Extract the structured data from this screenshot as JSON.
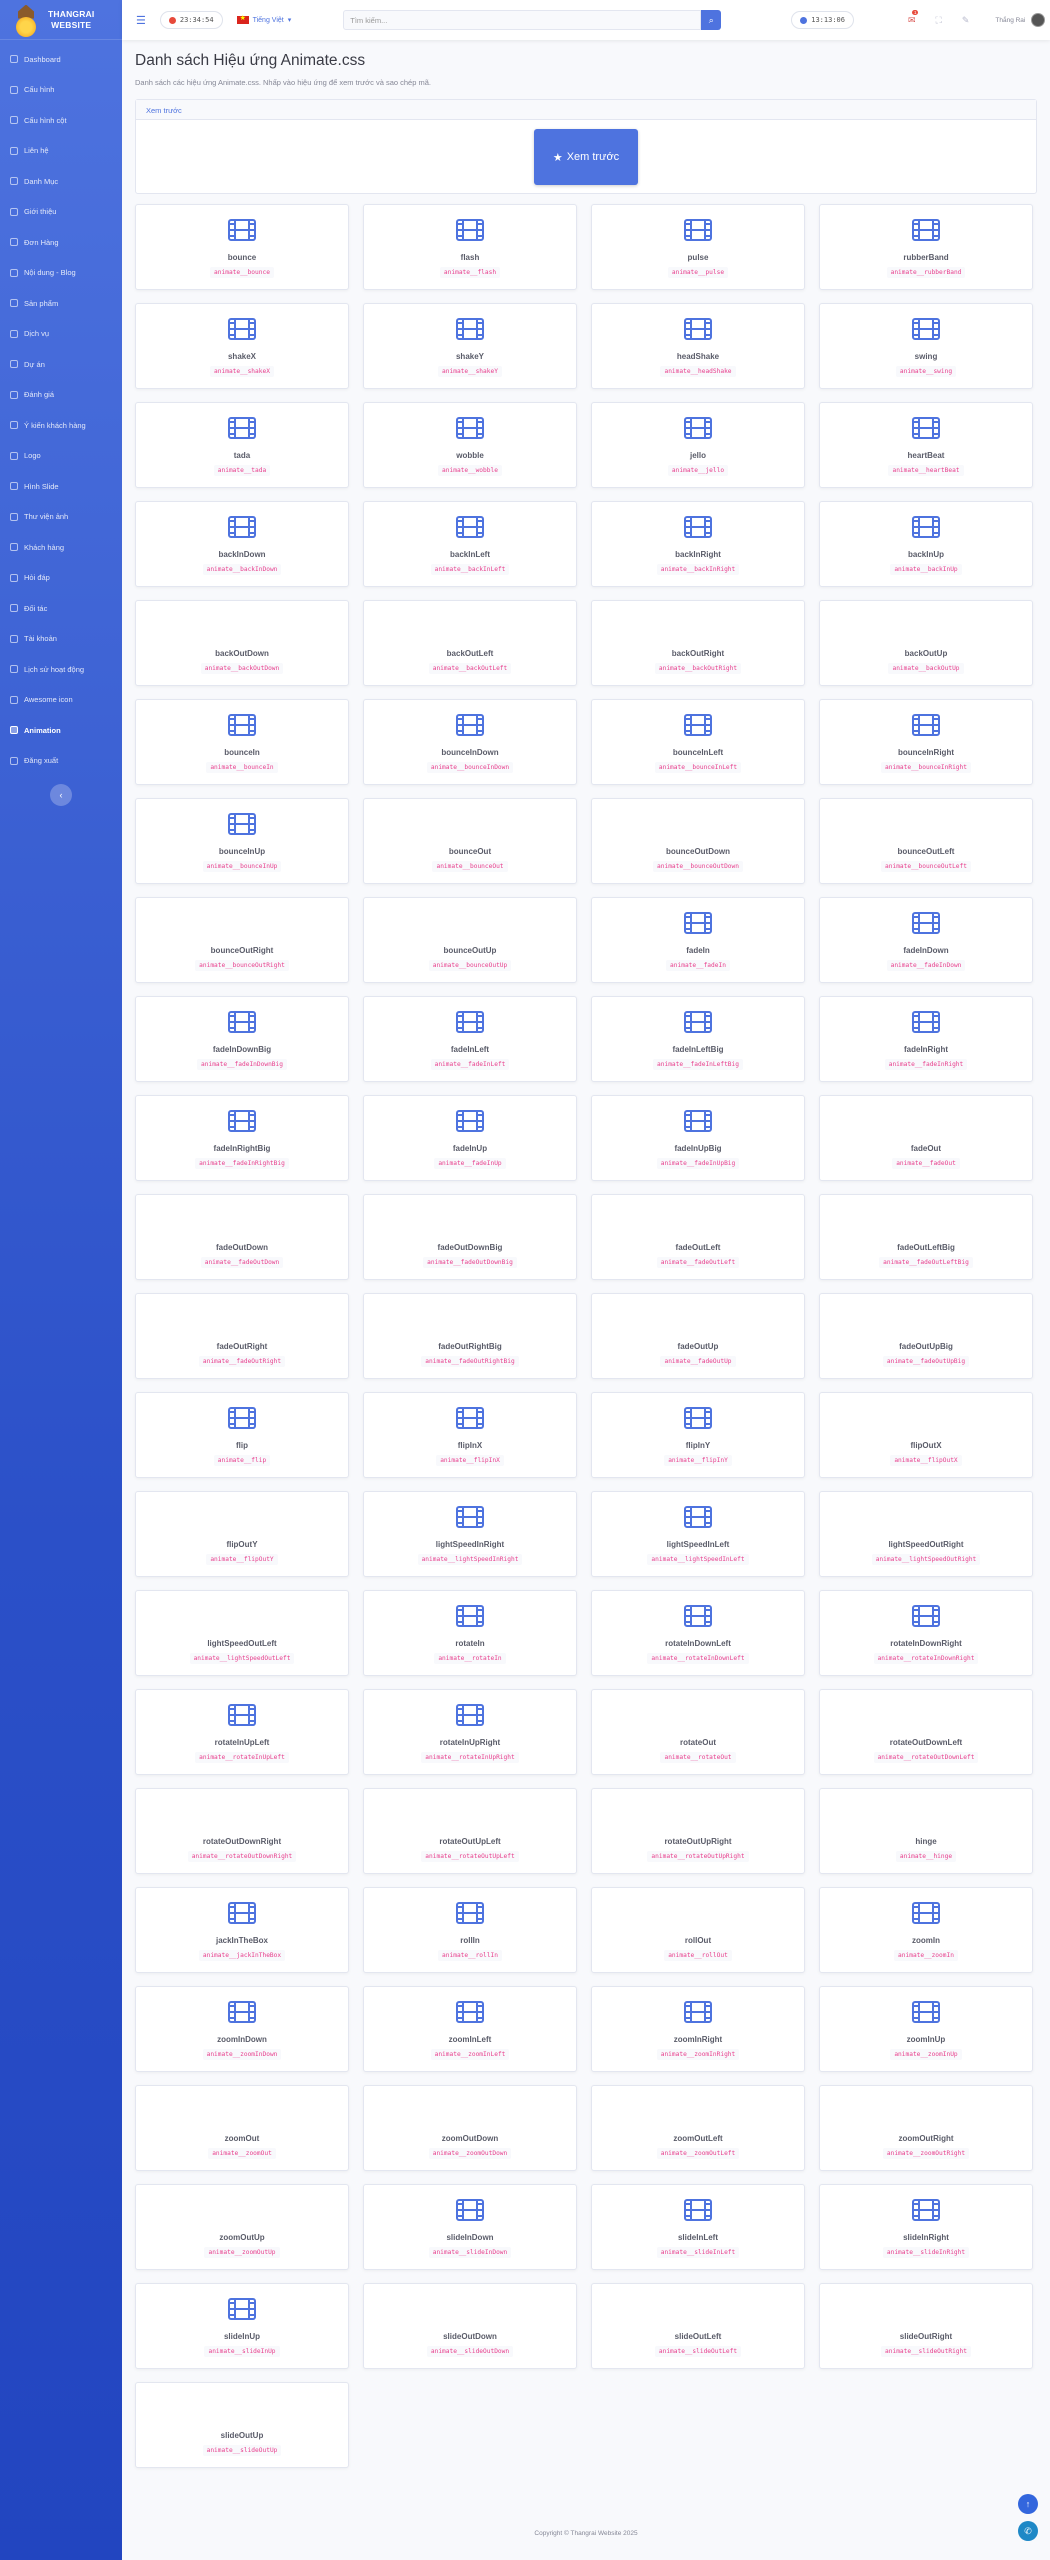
{
  "brand": {
    "line1": "THANGRAI",
    "line2": "WEBSITE"
  },
  "sidebar": {
    "items": [
      {
        "label": "Dashboard"
      },
      {
        "label": "Cấu hình"
      },
      {
        "label": "Cấu hình cột"
      },
      {
        "label": "Liên hệ"
      },
      {
        "label": "Danh Mục"
      },
      {
        "label": "Giới thiệu"
      },
      {
        "label": "Đơn Hàng"
      },
      {
        "label": "Nội dung - Blog"
      },
      {
        "label": "Sản phẩm"
      },
      {
        "label": "Dịch vụ"
      },
      {
        "label": "Dự án"
      },
      {
        "label": "Đánh giá"
      },
      {
        "label": "Ý kiến khách hàng"
      },
      {
        "label": "Logo"
      },
      {
        "label": "Hình Slide"
      },
      {
        "label": "Thư viện ảnh"
      },
      {
        "label": "Khách hàng"
      },
      {
        "label": "Hỏi đáp"
      },
      {
        "label": "Đối tác"
      },
      {
        "label": "Tài khoản"
      },
      {
        "label": "Lịch sử hoạt động"
      },
      {
        "label": "Awesome icon"
      },
      {
        "label": "Animation"
      },
      {
        "label": "Đăng xuất"
      }
    ],
    "active": "Animation",
    "toggle_icon": "‹"
  },
  "topbar": {
    "clock1": "23:34:54",
    "clock2": "13:13:06",
    "lang": "Tiếng Việt",
    "search_placeholder": "Tìm kiếm...",
    "badge": "1",
    "user": "Thắng Rai"
  },
  "page": {
    "title": "Danh sách Hiệu ứng Animate.css",
    "desc": "Danh sách các hiệu ứng Animate.css. Nhấp vào hiệu ứng để xem trước và sao chép mã.",
    "preview_header": "Xem trước",
    "preview_button": "Xem trước"
  },
  "animations": [
    {
      "name": "bounce",
      "cls": "animate__bounce",
      "icon": true
    },
    {
      "name": "flash",
      "cls": "animate__flash",
      "icon": true
    },
    {
      "name": "pulse",
      "cls": "animate__pulse",
      "icon": true
    },
    {
      "name": "rubberBand",
      "cls": "animate__rubberBand",
      "icon": true
    },
    {
      "name": "shakeX",
      "cls": "animate__shakeX",
      "icon": true
    },
    {
      "name": "shakeY",
      "cls": "animate__shakeY",
      "icon": true
    },
    {
      "name": "headShake",
      "cls": "animate__headShake",
      "icon": true
    },
    {
      "name": "swing",
      "cls": "animate__swing",
      "icon": true
    },
    {
      "name": "tada",
      "cls": "animate__tada",
      "icon": true
    },
    {
      "name": "wobble",
      "cls": "animate__wobble",
      "icon": true
    },
    {
      "name": "jello",
      "cls": "animate__jello",
      "icon": true
    },
    {
      "name": "heartBeat",
      "cls": "animate__heartBeat",
      "icon": true
    },
    {
      "name": "backInDown",
      "cls": "animate__backInDown",
      "icon": true
    },
    {
      "name": "backInLeft",
      "cls": "animate__backInLeft",
      "icon": true
    },
    {
      "name": "backInRight",
      "cls": "animate__backInRight",
      "icon": true
    },
    {
      "name": "backInUp",
      "cls": "animate__backInUp",
      "icon": true
    },
    {
      "name": "backOutDown",
      "cls": "animate__backOutDown",
      "icon": false
    },
    {
      "name": "backOutLeft",
      "cls": "animate__backOutLeft",
      "icon": false
    },
    {
      "name": "backOutRight",
      "cls": "animate__backOutRight",
      "icon": false
    },
    {
      "name": "backOutUp",
      "cls": "animate__backOutUp",
      "icon": false
    },
    {
      "name": "bounceIn",
      "cls": "animate__bounceIn",
      "icon": true
    },
    {
      "name": "bounceInDown",
      "cls": "animate__bounceInDown",
      "icon": true
    },
    {
      "name": "bounceInLeft",
      "cls": "animate__bounceInLeft",
      "icon": true
    },
    {
      "name": "bounceInRight",
      "cls": "animate__bounceInRight",
      "icon": true
    },
    {
      "name": "bounceInUp",
      "cls": "animate__bounceInUp",
      "icon": true
    },
    {
      "name": "bounceOut",
      "cls": "animate__bounceOut",
      "icon": false
    },
    {
      "name": "bounceOutDown",
      "cls": "animate__bounceOutDown",
      "icon": false
    },
    {
      "name": "bounceOutLeft",
      "cls": "animate__bounceOutLeft",
      "icon": false
    },
    {
      "name": "bounceOutRight",
      "cls": "animate__bounceOutRight",
      "icon": false
    },
    {
      "name": "bounceOutUp",
      "cls": "animate__bounceOutUp",
      "icon": false
    },
    {
      "name": "fadeIn",
      "cls": "animate__fadeIn",
      "icon": true
    },
    {
      "name": "fadeInDown",
      "cls": "animate__fadeInDown",
      "icon": true
    },
    {
      "name": "fadeInDownBig",
      "cls": "animate__fadeInDownBig",
      "icon": true
    },
    {
      "name": "fadeInLeft",
      "cls": "animate__fadeInLeft",
      "icon": true
    },
    {
      "name": "fadeInLeftBig",
      "cls": "animate__fadeInLeftBig",
      "icon": true
    },
    {
      "name": "fadeInRight",
      "cls": "animate__fadeInRight",
      "icon": true
    },
    {
      "name": "fadeInRightBig",
      "cls": "animate__fadeInRightBig",
      "icon": true
    },
    {
      "name": "fadeInUp",
      "cls": "animate__fadeInUp",
      "icon": true
    },
    {
      "name": "fadeInUpBig",
      "cls": "animate__fadeInUpBig",
      "icon": true
    },
    {
      "name": "fadeOut",
      "cls": "animate__fadeOut",
      "icon": false
    },
    {
      "name": "fadeOutDown",
      "cls": "animate__fadeOutDown",
      "icon": false
    },
    {
      "name": "fadeOutDownBig",
      "cls": "animate__fadeOutDownBig",
      "icon": false
    },
    {
      "name": "fadeOutLeft",
      "cls": "animate__fadeOutLeft",
      "icon": false
    },
    {
      "name": "fadeOutLeftBig",
      "cls": "animate__fadeOutLeftBig",
      "icon": false
    },
    {
      "name": "fadeOutRight",
      "cls": "animate__fadeOutRight",
      "icon": false
    },
    {
      "name": "fadeOutRightBig",
      "cls": "animate__fadeOutRightBig",
      "icon": false
    },
    {
      "name": "fadeOutUp",
      "cls": "animate__fadeOutUp",
      "icon": false
    },
    {
      "name": "fadeOutUpBig",
      "cls": "animate__fadeOutUpBig",
      "icon": false
    },
    {
      "name": "flip",
      "cls": "animate__flip",
      "icon": true
    },
    {
      "name": "flipInX",
      "cls": "animate__flipInX",
      "icon": true
    },
    {
      "name": "flipInY",
      "cls": "animate__flipInY",
      "icon": true
    },
    {
      "name": "flipOutX",
      "cls": "animate__flipOutX",
      "icon": false
    },
    {
      "name": "flipOutY",
      "cls": "animate__flipOutY",
      "icon": false
    },
    {
      "name": "lightSpeedInRight",
      "cls": "animate__lightSpeedInRight",
      "icon": true
    },
    {
      "name": "lightSpeedInLeft",
      "cls": "animate__lightSpeedInLeft",
      "icon": true
    },
    {
      "name": "lightSpeedOutRight",
      "cls": "animate__lightSpeedOutRight",
      "icon": false
    },
    {
      "name": "lightSpeedOutLeft",
      "cls": "animate__lightSpeedOutLeft",
      "icon": false
    },
    {
      "name": "rotateIn",
      "cls": "animate__rotateIn",
      "icon": true
    },
    {
      "name": "rotateInDownLeft",
      "cls": "animate__rotateInDownLeft",
      "icon": true
    },
    {
      "name": "rotateInDownRight",
      "cls": "animate__rotateInDownRight",
      "icon": true
    },
    {
      "name": "rotateInUpLeft",
      "cls": "animate__rotateInUpLeft",
      "icon": true
    },
    {
      "name": "rotateInUpRight",
      "cls": "animate__rotateInUpRight",
      "icon": true
    },
    {
      "name": "rotateOut",
      "cls": "animate__rotateOut",
      "icon": false
    },
    {
      "name": "rotateOutDownLeft",
      "cls": "animate__rotateOutDownLeft",
      "icon": false
    },
    {
      "name": "rotateOutDownRight",
      "cls": "animate__rotateOutDownRight",
      "icon": false
    },
    {
      "name": "rotateOutUpLeft",
      "cls": "animate__rotateOutUpLeft",
      "icon": false
    },
    {
      "name": "rotateOutUpRight",
      "cls": "animate__rotateOutUpRight",
      "icon": false
    },
    {
      "name": "hinge",
      "cls": "animate__hinge",
      "icon": false
    },
    {
      "name": "jackInTheBox",
      "cls": "animate__jackInTheBox",
      "icon": true
    },
    {
      "name": "rollIn",
      "cls": "animate__rollIn",
      "icon": true
    },
    {
      "name": "rollOut",
      "cls": "animate__rollOut",
      "icon": false
    },
    {
      "name": "zoomIn",
      "cls": "animate__zoomIn",
      "icon": true
    },
    {
      "name": "zoomInDown",
      "cls": "animate__zoomInDown",
      "icon": true
    },
    {
      "name": "zoomInLeft",
      "cls": "animate__zoomInLeft",
      "icon": true
    },
    {
      "name": "zoomInRight",
      "cls": "animate__zoomInRight",
      "icon": true
    },
    {
      "name": "zoomInUp",
      "cls": "animate__zoomInUp",
      "icon": true
    },
    {
      "name": "zoomOut",
      "cls": "animate__zoomOut",
      "icon": false
    },
    {
      "name": "zoomOutDown",
      "cls": "animate__zoomOutDown",
      "icon": false
    },
    {
      "name": "zoomOutLeft",
      "cls": "animate__zoomOutLeft",
      "icon": false
    },
    {
      "name": "zoomOutRight",
      "cls": "animate__zoomOutRight",
      "icon": false
    },
    {
      "name": "zoomOutUp",
      "cls": "animate__zoomOutUp",
      "icon": false
    },
    {
      "name": "slideInDown",
      "cls": "animate__slideInDown",
      "icon": true
    },
    {
      "name": "slideInLeft",
      "cls": "animate__slideInLeft",
      "icon": true
    },
    {
      "name": "slideInRight",
      "cls": "animate__slideInRight",
      "icon": true
    },
    {
      "name": "slideInUp",
      "cls": "animate__slideInUp",
      "icon": true
    },
    {
      "name": "slideOutDown",
      "cls": "animate__slideOutDown",
      "icon": false
    },
    {
      "name": "slideOutLeft",
      "cls": "animate__slideOutLeft",
      "icon": false
    },
    {
      "name": "slideOutRight",
      "cls": "animate__slideOutRight",
      "icon": false
    },
    {
      "name": "slideOutUp",
      "cls": "animate__slideOutUp",
      "icon": false
    }
  ],
  "footer": "Copyright © Thangrai Website 2025",
  "colors": {
    "accent": "#4e73df",
    "code": "#e83e8c",
    "sidebar": "#3a5fd6",
    "fab_up": "#3366dd",
    "fab_chat": "#1e88c6"
  },
  "icons": {
    "film": "film-icon",
    "star": "star-icon",
    "bars": "bars-icon",
    "search": "search-icon",
    "bell": "bell-icon"
  }
}
